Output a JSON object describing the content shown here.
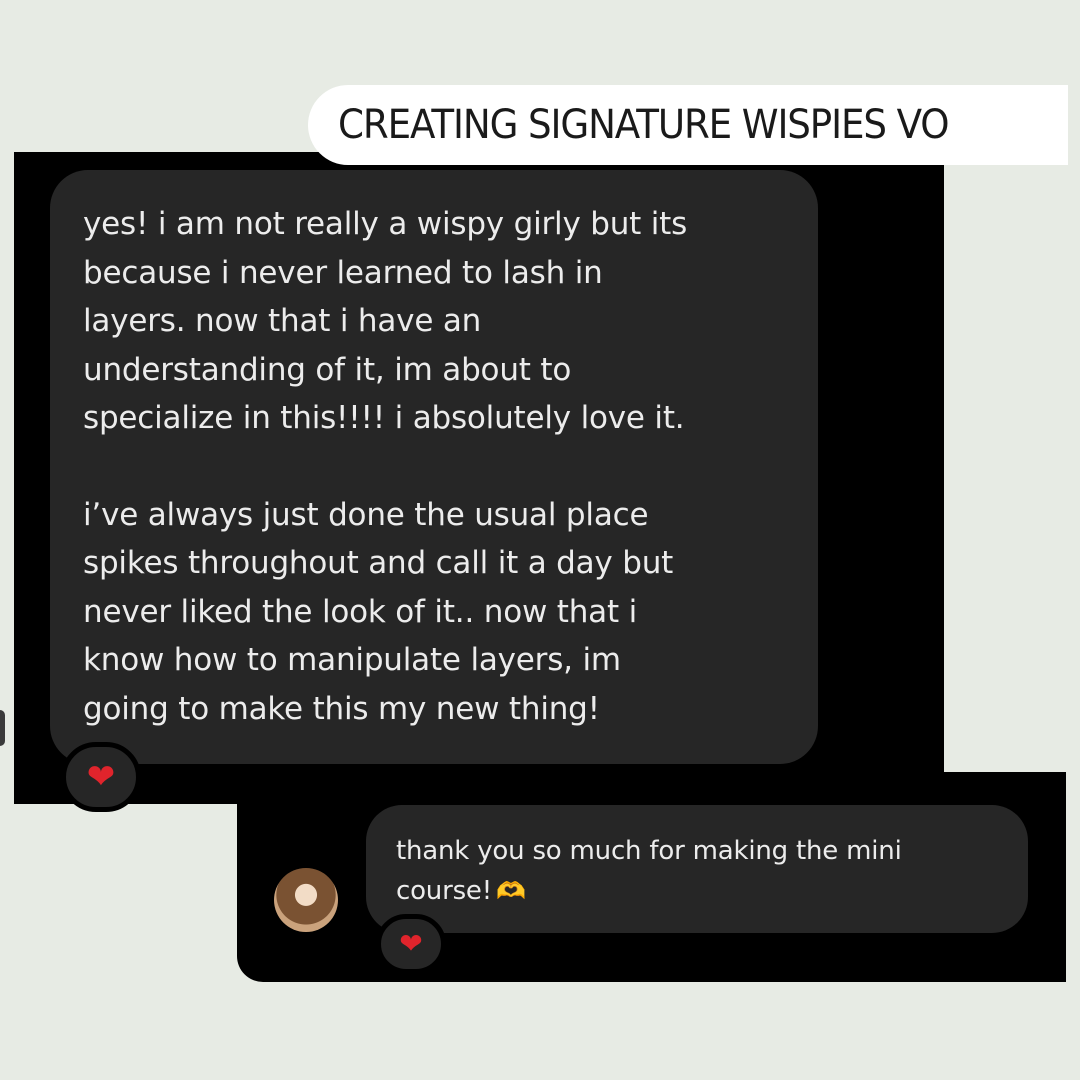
{
  "header": {
    "title": "CREATING SIGNATURE WISPIES VO"
  },
  "messages": [
    {
      "paragraphs": [
        "yes! i am not really a wispy girly but its\nbecause i never learned to lash in\nlayers. now that i have an\nunderstanding of it, im about to\nspecialize in this!!!! i absolutely love it.",
        "i’ve always just done the usual place\nspikes throughout and call it a day but\nnever liked the look of it.. now that i\nknow how to manipulate layers, im\ngoing to make this my new thing!"
      ],
      "reaction": "❤"
    },
    {
      "text": "thank you so much for making the mini\ncourse!",
      "emoji": "🫶",
      "reaction": "❤"
    }
  ],
  "icons": {
    "reaction": "heart-icon",
    "emoji": "heart-hands-icon",
    "avatar": "user-avatar"
  },
  "colors": {
    "background": "#e7ebe4",
    "card": "#000000",
    "bubble": "#262626",
    "text": "#ececec",
    "heart": "#e0242c"
  }
}
